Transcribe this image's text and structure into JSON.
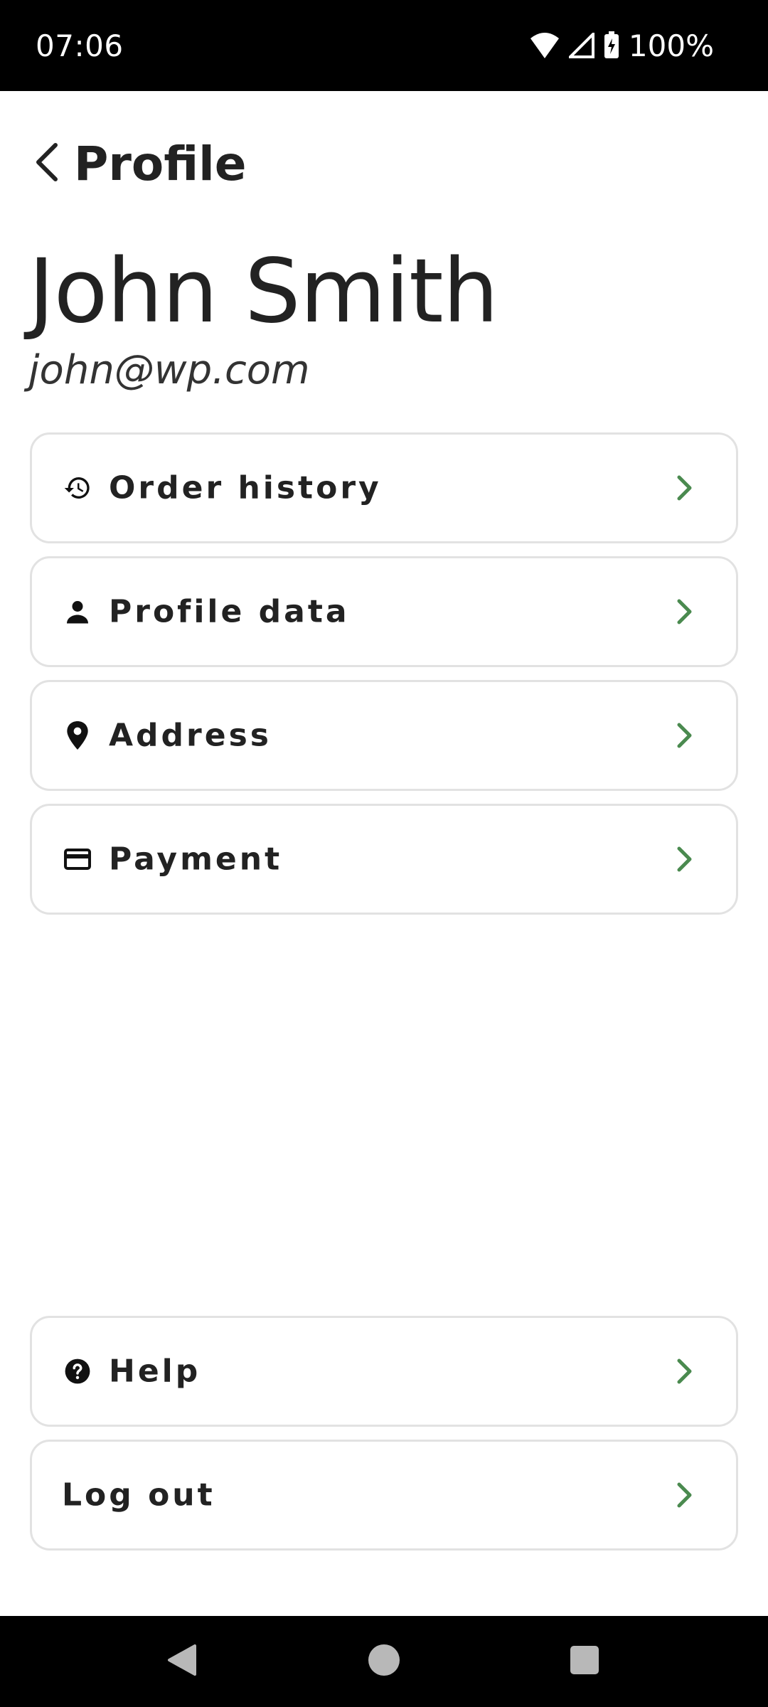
{
  "status_bar": {
    "time": "07:06",
    "battery": "100%",
    "icons": [
      "wifi-icon",
      "signal-icon",
      "battery-charging-icon"
    ]
  },
  "header": {
    "back_icon": "chevron-left-icon",
    "title": "Profile"
  },
  "user": {
    "name": "John Smith",
    "email": "john@wp.com"
  },
  "menu": {
    "items": [
      {
        "label": "Order history",
        "icon": "history-icon"
      },
      {
        "label": "Profile data",
        "icon": "person-icon"
      },
      {
        "label": "Address",
        "icon": "location-pin-icon"
      },
      {
        "label": "Payment",
        "icon": "credit-card-icon"
      }
    ],
    "bottom_items": [
      {
        "label": "Help",
        "icon": "help-circle-icon"
      },
      {
        "label": "Log out"
      }
    ]
  },
  "colors": {
    "accent": "#4a8a4f",
    "text": "#222222",
    "card_border": "#e2e2e2",
    "system_bar": "#000000"
  },
  "nav_bar": {
    "buttons": [
      "back-triangle-icon",
      "home-circle-icon",
      "recents-square-icon"
    ]
  }
}
